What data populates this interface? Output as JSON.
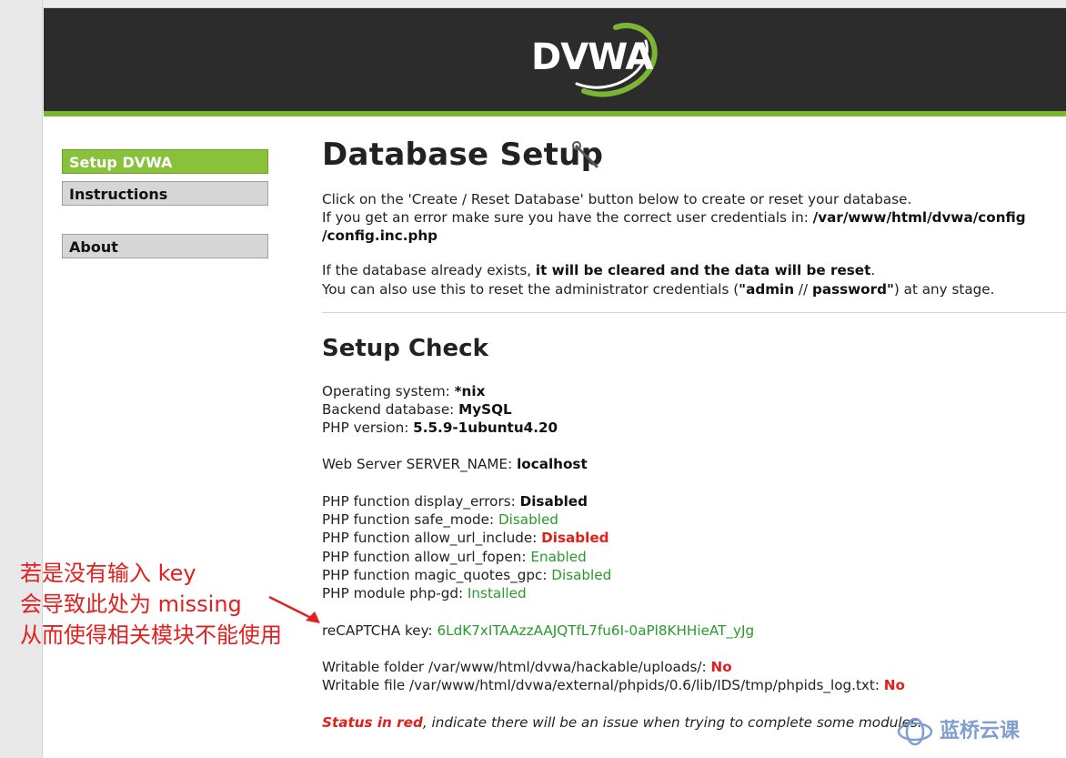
{
  "brand": {
    "logo_text": "DVWA"
  },
  "menu": [
    {
      "label": "Setup DVWA",
      "selected": true
    },
    {
      "label": "Instructions",
      "selected": false
    },
    {
      "label": "About",
      "selected": false
    }
  ],
  "page": {
    "title": "Database Setup",
    "intro_line1": "Click on the 'Create / Reset Database' button below to create or reset your database.",
    "intro_line2_pre": "If you get an error make sure you have the correct user credentials in: ",
    "intro_line2_path": "/var/www/html/dvwa/config",
    "intro_line3_path": "/config.inc.php",
    "reset_line1_pre": "If the database already exists, ",
    "reset_line1_bold": "it will be cleared and the data will be reset",
    "reset_line1_post": ".",
    "reset_line2_pre": "You can also use this to reset the administrator credentials (",
    "reset_line2_admin": "\"admin",
    "reset_line2_sep": " // ",
    "reset_line2_password": "password\"",
    "reset_line2_post": ") at any stage."
  },
  "setup_check": {
    "heading": "Setup Check",
    "os_label": "Operating system: ",
    "os_value": "*nix",
    "db_label": "Backend database: ",
    "db_value": "MySQL",
    "php_label": "PHP version: ",
    "php_value": "5.5.9-1ubuntu4.20",
    "server_label": "Web Server SERVER_NAME: ",
    "server_value": "localhost",
    "display_errors_label": "PHP function display_errors: ",
    "display_errors_value": "Disabled",
    "safe_mode_label": "PHP function safe_mode: ",
    "safe_mode_value": "Disabled",
    "allow_url_include_label": "PHP function allow_url_include: ",
    "allow_url_include_value": "Disabled",
    "allow_url_fopen_label": "PHP function allow_url_fopen: ",
    "allow_url_fopen_value": "Enabled",
    "magic_quotes_label": "PHP function magic_quotes_gpc: ",
    "magic_quotes_value": "Disabled",
    "gd_label": "PHP module php-gd: ",
    "gd_value": "Installed",
    "recaptcha_label": "reCAPTCHA key: ",
    "recaptcha_value": "6LdK7xITAAzzAAJQTfL7fu6I-0aPl8KHHieAT_yJg",
    "writable_folder_label": "Writable folder /var/www/html/dvwa/hackable/uploads/: ",
    "writable_folder_value": "No",
    "writable_file_label": "Writable file /var/www/html/dvwa/external/phpids/0.6/lib/IDS/tmp/phpids_log.txt: ",
    "writable_file_value": "No",
    "status_red": "Status in red",
    "status_rest": ", indicate there will be an issue when trying to complete some modules."
  },
  "annotation": {
    "line1": "若是没有输入 key",
    "line2": "会导致此处为 missing",
    "line3": "从而使得相关模块不能使用"
  },
  "watermark": {
    "text": "蓝桥云课"
  },
  "colors": {
    "accent_green": "#7cb533",
    "header_dark": "#2c2c2c",
    "error_red": "#e0201c",
    "ok_green": "#2a9a2a"
  }
}
